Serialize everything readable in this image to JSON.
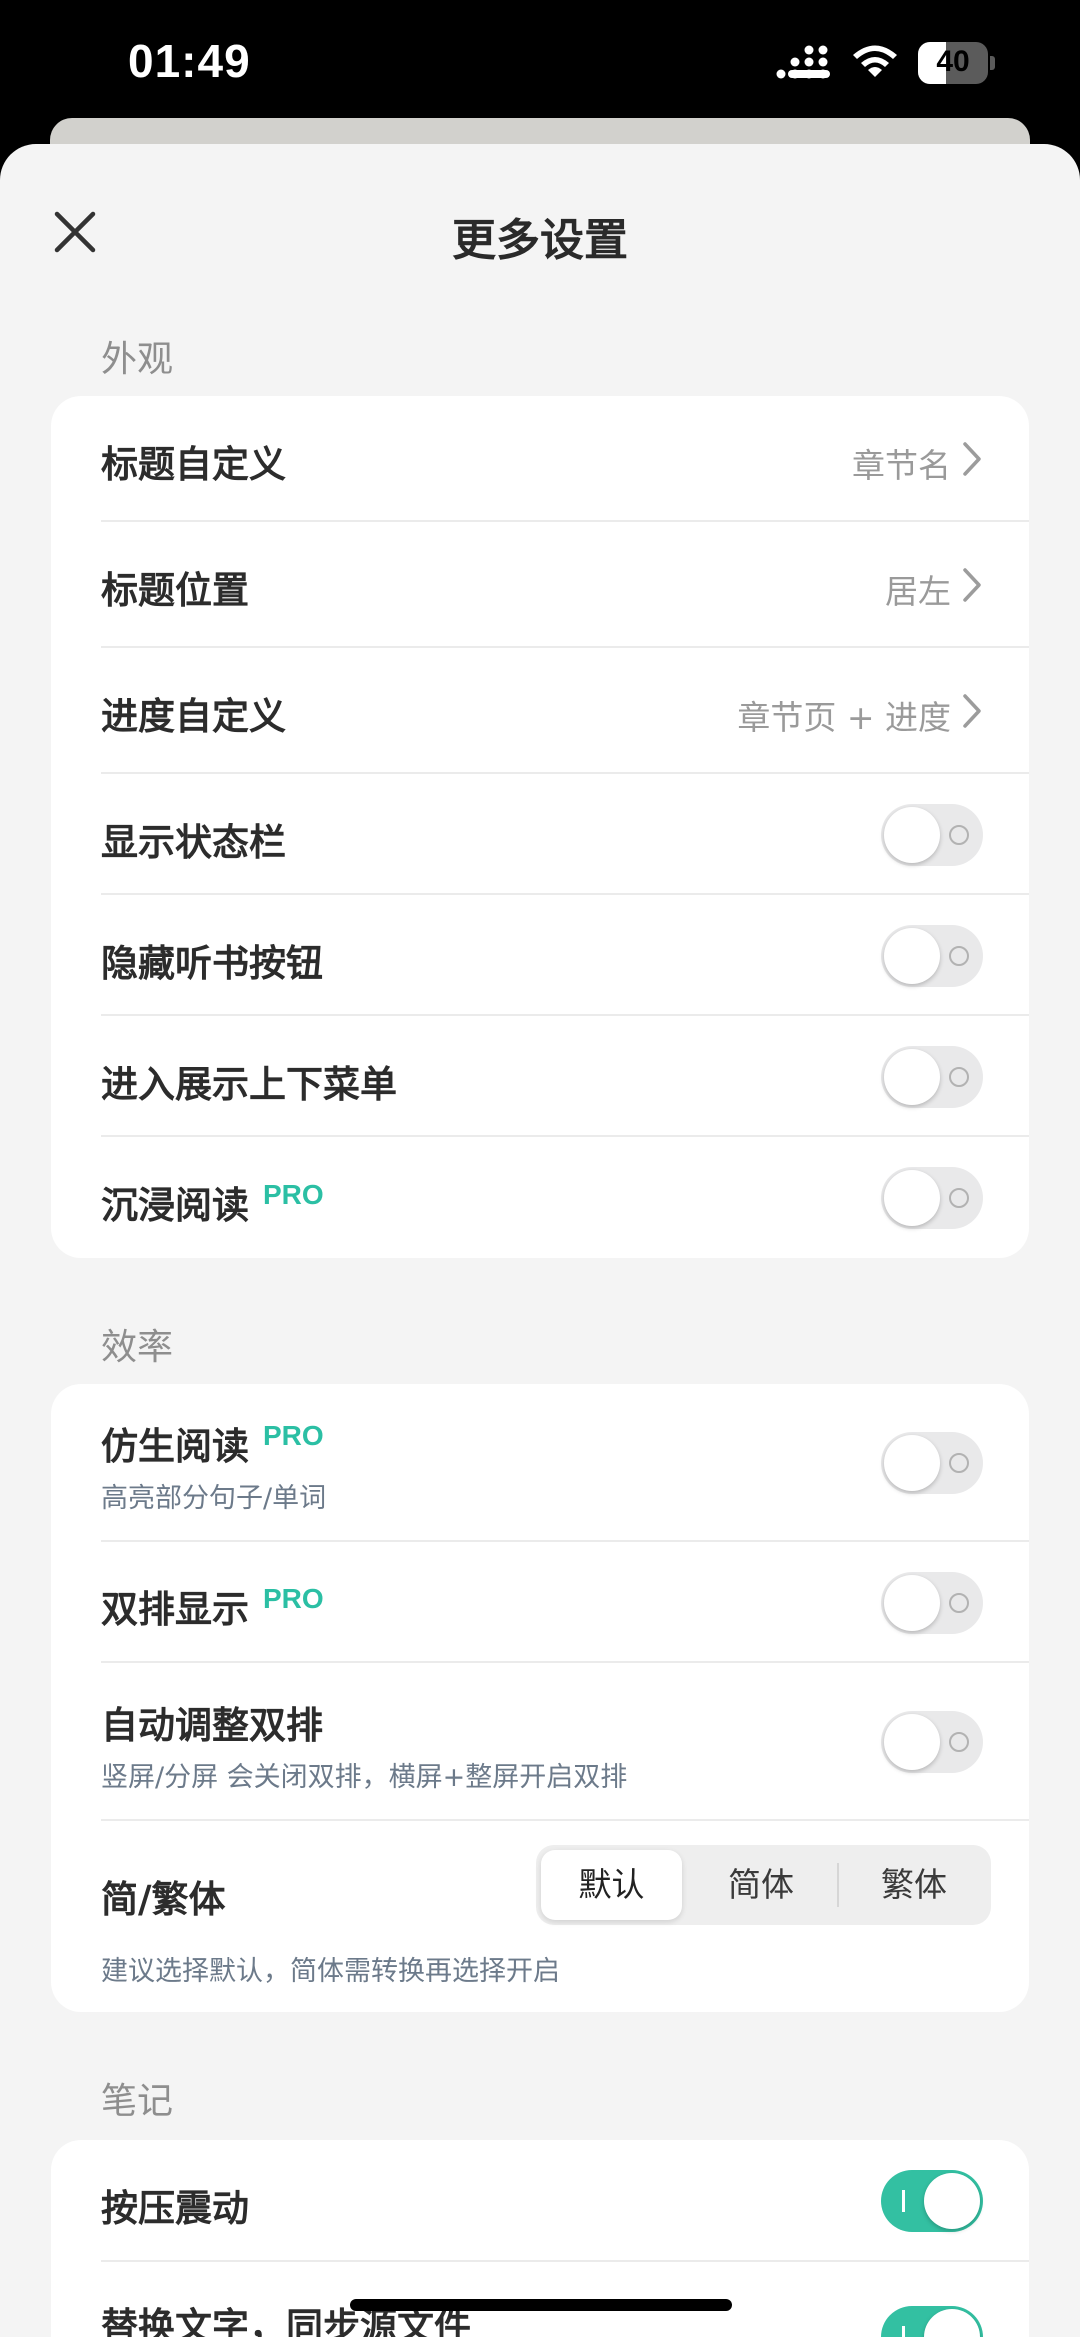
{
  "status_bar": {
    "time": "01:49",
    "battery": "40",
    "battery_level": 0.4
  },
  "sheet": {
    "title": "更多设置"
  },
  "appearance": {
    "label": "外观",
    "title_custom": {
      "label": "标题自定义",
      "value": "章节名"
    },
    "title_position": {
      "label": "标题位置",
      "value": "居左"
    },
    "progress_custom": {
      "label": "进度自定义",
      "value": "章节页 + 进度"
    },
    "show_status_bar": {
      "label": "显示状态栏",
      "enabled": false
    },
    "hide_listen_button": {
      "label": "隐藏听书按钮",
      "enabled": false
    },
    "show_menus_on_enter": {
      "label": "进入展示上下菜单",
      "enabled": false
    },
    "immersive_reading": {
      "label": "沉浸阅读",
      "badge": "PRO",
      "enabled": false
    }
  },
  "efficiency": {
    "label": "效率",
    "bionic_reading": {
      "label": "仿生阅读",
      "badge": "PRO",
      "sub": "高亮部分句子/单词",
      "enabled": false
    },
    "dual_column": {
      "label": "双排显示",
      "badge": "PRO",
      "enabled": false
    },
    "auto_dual_column": {
      "label": "自动调整双排",
      "sub": "竖屏/分屏 会关闭双排，横屏+整屏开启双排",
      "enabled": false
    },
    "script_variant": {
      "label": "简/繁体",
      "options": [
        "默认",
        "简体",
        "繁体"
      ],
      "selected": "默认",
      "hint": "建议选择默认，简体需转换再选择开启"
    }
  },
  "notes": {
    "label": "笔记",
    "press_vibration": {
      "label": "按压震动",
      "enabled": true
    },
    "replace_text_sync": {
      "label": "替换文字，同步源文件",
      "enabled": true
    }
  }
}
